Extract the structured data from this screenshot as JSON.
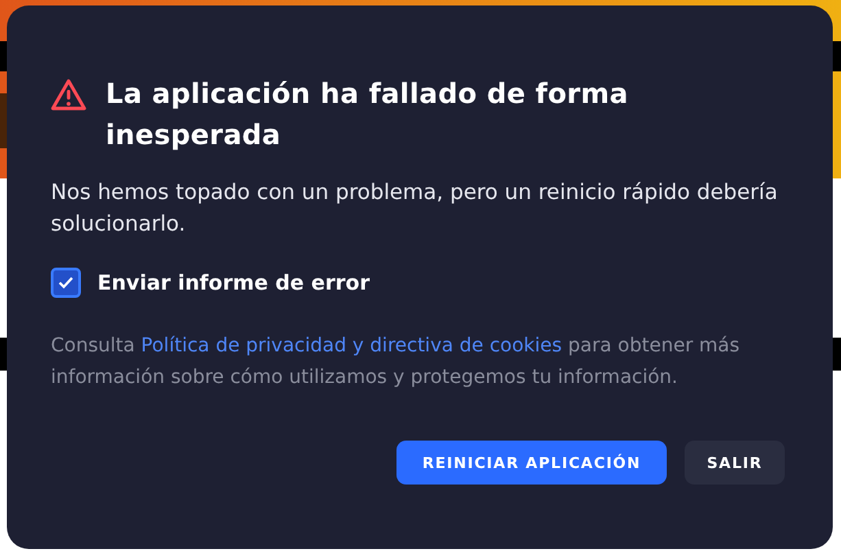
{
  "dialog": {
    "title": "La aplicación ha fallado de forma inesperada",
    "message": "Nos hemos topado con un problema, pero un reinicio rápido debería solucionarlo.",
    "checkbox": {
      "label": "Enviar informe de error",
      "checked": true
    },
    "legal": {
      "before": "Consulta ",
      "link": "Política de privacidad y directiva de cookies",
      "after": " para obtener más información sobre cómo utilizamos y protegemos tu información."
    },
    "buttons": [
      {
        "label": "REINICIAR APLICACIÓN",
        "kind": "primary"
      },
      {
        "label": "SALIR",
        "kind": "secondary"
      }
    ]
  }
}
